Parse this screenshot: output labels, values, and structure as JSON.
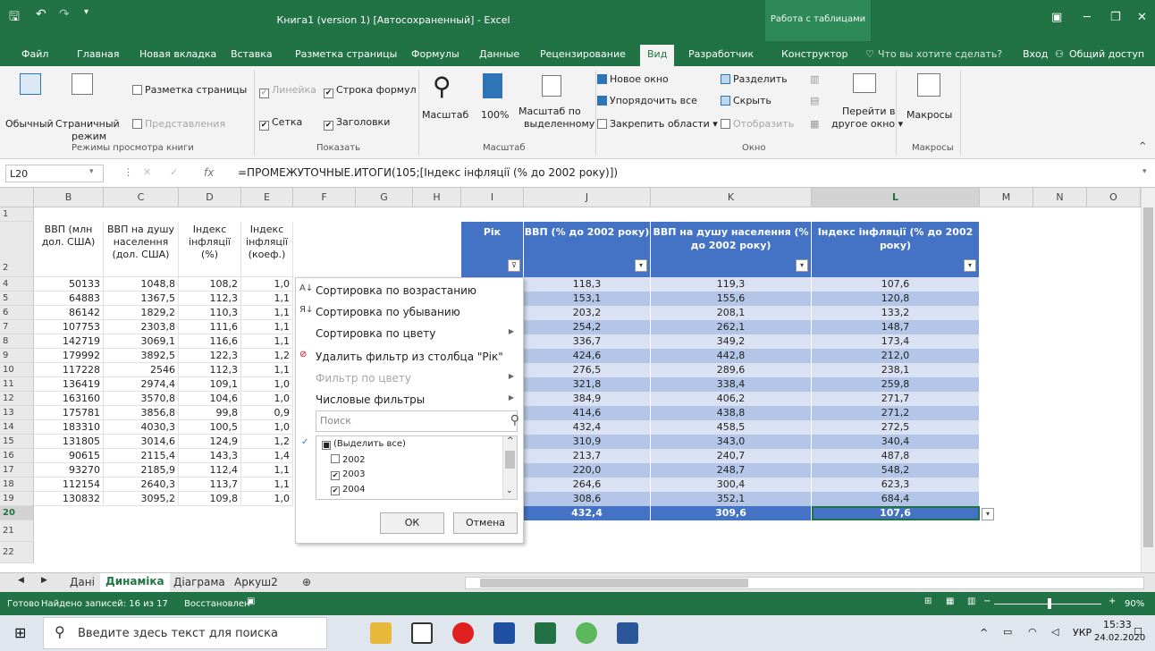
{
  "title_bar": {
    "doc_title": "Книга1 (version 1) [Автосохраненный]  -  Excel",
    "context_label": "Работа с таблицами"
  },
  "ribbon_tabs": [
    "Файл",
    "Главная",
    "Новая вкладка",
    "Вставка",
    "Разметка страницы",
    "Формулы",
    "Данные",
    "Рецензирование",
    "Вид",
    "Разработчик",
    "Конструктор"
  ],
  "ribbon_extra": {
    "tell_me": "Что вы хотите сделать?",
    "signin": "Вход",
    "share": "Общий доступ"
  },
  "ribbon": {
    "views": {
      "normal": "Обычный",
      "page_break": "Страничный",
      "page_break2": "режим",
      "page_layout": "Разметка страницы",
      "custom": "Представления",
      "label": "Режимы просмотра книги"
    },
    "show": {
      "ruler": "Линейка",
      "formula_bar": "Строка формул",
      "gridlines": "Сетка",
      "headings": "Заголовки",
      "label": "Показать"
    },
    "zoom": {
      "zoom": "Масштаб",
      "hundred": "100%",
      "zoom_sel": "Масштаб по",
      "zoom_sel2": "выделенному",
      "label": "Масштаб"
    },
    "window": {
      "new": "Новое окно",
      "arrange": "Упорядочить все",
      "freeze": "Закрепить области",
      "split": "Разделить",
      "hide": "Скрыть",
      "unhide": "Отобразить",
      "switch": "Перейти в",
      "switch2": "другое окно",
      "label": "Окно"
    },
    "macros": {
      "macros": "Макросы",
      "label": "Макросы"
    }
  },
  "formula_bar": {
    "name_box": "L20",
    "formula": "=ПРОМЕЖУТОЧНЫЕ.ИТОГИ(105;[Індекс інфляції (% до 2002 року)])"
  },
  "columns": [
    "B",
    "C",
    "D",
    "E",
    "F",
    "G",
    "H",
    "I",
    "J",
    "K",
    "L",
    "M",
    "N",
    "O"
  ],
  "rows": [
    "1",
    "2",
    "4",
    "5",
    "6",
    "7",
    "8",
    "9",
    "10",
    "11",
    "12",
    "13",
    "14",
    "15",
    "16",
    "17",
    "18",
    "19",
    "20",
    "21",
    "22"
  ],
  "left_headers": [
    "ВВП (млн дол. США)",
    "ВВП на душу населення (дол. США)",
    "Індекс інфляції (%)",
    "Індекс інфляції (коеф.)"
  ],
  "left_data": [
    [
      "50133",
      "1048,8",
      "108,2",
      "1,0"
    ],
    [
      "64883",
      "1367,5",
      "112,3",
      "1,1"
    ],
    [
      "86142",
      "1829,2",
      "110,3",
      "1,1"
    ],
    [
      "107753",
      "2303,8",
      "111,6",
      "1,1"
    ],
    [
      "142719",
      "3069,1",
      "116,6",
      "1,1"
    ],
    [
      "179992",
      "3892,5",
      "122,3",
      "1,2"
    ],
    [
      "117228",
      "2546",
      "112,3",
      "1,1"
    ],
    [
      "136419",
      "2974,4",
      "109,1",
      "1,0"
    ],
    [
      "163160",
      "3570,8",
      "104,6",
      "1,0"
    ],
    [
      "175781",
      "3856,8",
      "99,8",
      "0,9"
    ],
    [
      "183310",
      "4030,3",
      "100,5",
      "1,0"
    ],
    [
      "131805",
      "3014,6",
      "124,9",
      "1,2"
    ],
    [
      "90615",
      "2115,4",
      "143,3",
      "1,4"
    ],
    [
      "93270",
      "2185,9",
      "112,4",
      "1,1"
    ],
    [
      "112154",
      "2640,3",
      "113,7",
      "1,1"
    ],
    [
      "130832",
      "3095,2",
      "109,8",
      "1,0"
    ]
  ],
  "table_headers": {
    "year": "Рік",
    "j": "ВВП (% до 2002 року)",
    "k": "ВВП на душу населення (% до 2002 року)",
    "l": "Індекс інфляції (% до 2002 року)"
  },
  "table_data": [
    [
      "118,3",
      "119,3",
      "107,6"
    ],
    [
      "153,1",
      "155,6",
      "120,8"
    ],
    [
      "203,2",
      "208,1",
      "133,2"
    ],
    [
      "254,2",
      "262,1",
      "148,7"
    ],
    [
      "336,7",
      "349,2",
      "173,4"
    ],
    [
      "424,6",
      "442,8",
      "212,0"
    ],
    [
      "276,5",
      "289,6",
      "238,1"
    ],
    [
      "321,8",
      "338,4",
      "259,8"
    ],
    [
      "384,9",
      "406,2",
      "271,7"
    ],
    [
      "414,6",
      "438,8",
      "271,2"
    ],
    [
      "432,4",
      "458,5",
      "272,5"
    ],
    [
      "310,9",
      "343,0",
      "340,4"
    ],
    [
      "213,7",
      "240,7",
      "487,8"
    ],
    [
      "220,0",
      "248,7",
      "548,2"
    ],
    [
      "264,6",
      "300,4",
      "623,3"
    ],
    [
      "308,6",
      "352,1",
      "684,4"
    ]
  ],
  "total_row": [
    "432,4",
    "309,6",
    "107,6"
  ],
  "filter_menu": {
    "sort_asc": "Сортировка по возрастанию",
    "sort_desc": "Сортировка по убыванию",
    "sort_color": "Сортировка по цвету",
    "clear_filter": "Удалить фильтр из столбца \"Рік\"",
    "filter_color": "Фильтр по цвету",
    "number_filters": "Числовые фильтры",
    "search_placeholder": "Поиск",
    "items": [
      {
        "label": "(Выделить все)",
        "mark": "■"
      },
      {
        "label": "2002",
        "mark": ""
      },
      {
        "label": "2003",
        "mark": "✔"
      },
      {
        "label": "2004",
        "mark": "✔"
      }
    ],
    "ok": "ОК",
    "cancel": "Отмена"
  },
  "sheet_tabs": [
    "Дані",
    "Динаміка",
    "Діаграма",
    "Аркуш2"
  ],
  "status": {
    "ready": "Готово",
    "found": "Найдено записей: 16 из 17",
    "recovered": "Восстановлен",
    "zoom": "90%"
  },
  "taskbar": {
    "search": "Введите здесь текст для поиска",
    "lang": "УКР",
    "time": "15:33",
    "date": "24.02.2020"
  }
}
